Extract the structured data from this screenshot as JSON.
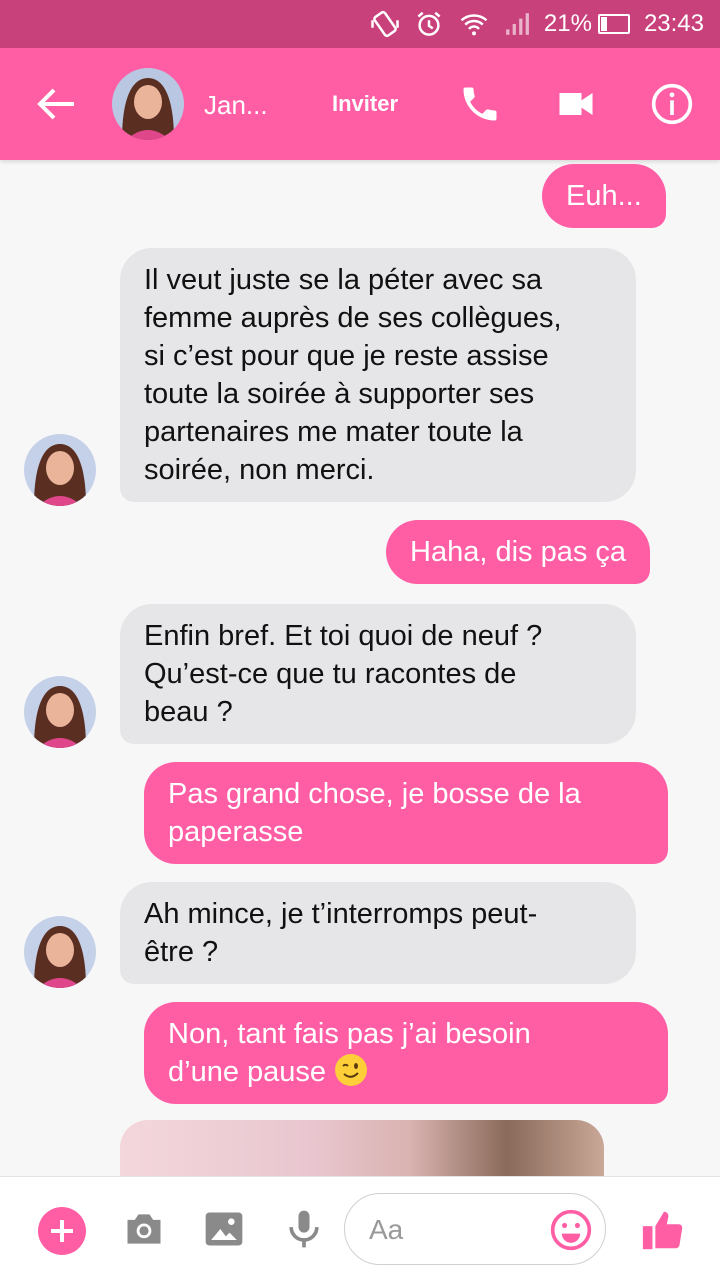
{
  "status_bar": {
    "battery": "21%",
    "battery_level": 0.21,
    "time": "23:43"
  },
  "header": {
    "contact_name": "Jan...",
    "invite_label": "Inviter"
  },
  "messages": [
    {
      "direction": "out",
      "text": "Euh..."
    },
    {
      "direction": "in",
      "lines": [
        "Il veut juste se la péter avec sa",
        "femme auprès de ses collègues,",
        "si c’est pour que je reste assise",
        "toute la soirée à supporter ses",
        "partenaires me mater toute la",
        "soirée, non merci."
      ]
    },
    {
      "direction": "out",
      "text": "Haha, dis pas ça"
    },
    {
      "direction": "in",
      "lines": [
        "Enfin bref. Et toi quoi de neuf ?",
        "Qu’est-ce que tu racontes de",
        "beau ?"
      ]
    },
    {
      "direction": "out",
      "lines": [
        "Pas grand chose, je bosse de la",
        "paperasse"
      ]
    },
    {
      "direction": "in",
      "lines": [
        "Ah mince, je t’interromps peut-",
        "être ?"
      ]
    },
    {
      "direction": "out",
      "lines": [
        "Non, tant fais pas j’ai besoin",
        "d’une pause"
      ],
      "emoji": "wink-emoji"
    }
  ],
  "composer": {
    "placeholder": "Aa"
  },
  "colors": {
    "status_bar": "#c9417b",
    "header": "#ff5ea5",
    "outgoing_bubble": "#ff5ea5",
    "incoming_bubble": "#e6e6e8",
    "composer_icons": "#8a8a8a"
  },
  "icons": [
    "back-arrow-icon",
    "phone-icon",
    "video-camera-icon",
    "info-icon",
    "plus-icon",
    "camera-icon",
    "image-icon",
    "microphone-icon",
    "smiley-icon",
    "thumbs-up-icon"
  ]
}
